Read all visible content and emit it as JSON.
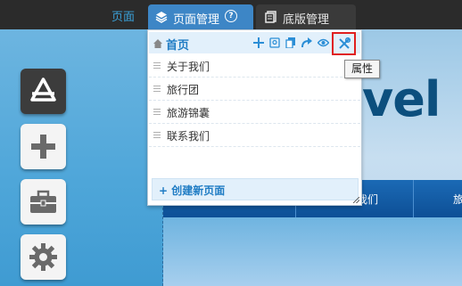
{
  "top_tabs": {
    "page_link": "页面",
    "page_manage": "页面管理",
    "help": "?",
    "template_manage": "底版管理"
  },
  "page_panel": {
    "home": "首页",
    "pages": [
      "关于我们",
      "旅行团",
      "旅游锦囊",
      "联系我们"
    ],
    "create_new": "+ 创建新页面",
    "actions": [
      "add-icon",
      "seo-icon",
      "copy-icon",
      "redirect-icon",
      "visibility-icon",
      "properties-icon"
    ]
  },
  "tooltip": "属性",
  "site_preview": {
    "hero_text": "vel",
    "nav_items": [
      "我们",
      "旅"
    ]
  },
  "colors": {
    "accent": "#3d86c6",
    "link": "#1f7cc4",
    "highlight_border": "#e02020"
  }
}
